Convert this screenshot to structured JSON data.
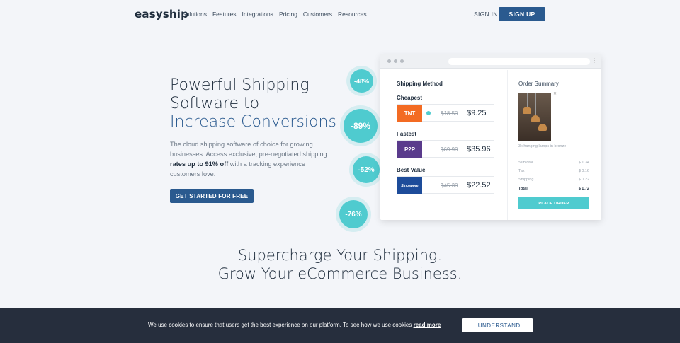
{
  "nav": {
    "logo": "easyship",
    "links": [
      "Solutions",
      "Features",
      "Integrations",
      "Pricing",
      "Customers",
      "Resources"
    ],
    "signin": "SIGN IN",
    "signup": "SIGN UP"
  },
  "hero": {
    "title_line1": "Powerful Shipping",
    "title_line2": "Software to",
    "title_line3": "Increase Conversions",
    "desc_part1": "The cloud shipping software of choice for growing businesses. Access exclusive, pre-negotiated shipping ",
    "desc_bold": "rates up to 91% off",
    "desc_part2": " with a tracking experience customers love.",
    "cta": "GET STARTED FOR FREE"
  },
  "bubbles": [
    "-48%",
    "-89%",
    "-52%",
    "-76%"
  ],
  "shipping_method": {
    "title": "Shipping Method",
    "options": [
      {
        "label": "Cheapest",
        "carrier": "TNT",
        "old_price": "$18.50",
        "new_price": "$9.25",
        "color": "#f36b23"
      },
      {
        "label": "Fastest",
        "carrier": "P2P",
        "old_price": "$69.90",
        "new_price": "$35.96",
        "color": "#5a3b8c"
      },
      {
        "label": "Best Value",
        "carrier": "Singapore",
        "old_price": "$45.30",
        "new_price": "$22.52",
        "color": "#1d4c9a"
      }
    ]
  },
  "order_summary": {
    "title": "Order Summary",
    "product_name": "3x hanging lamps in bronze",
    "rows": [
      {
        "label": "Subtotal",
        "value": "$ 1.34"
      },
      {
        "label": "Tax",
        "value": "$ 0.16"
      },
      {
        "label": "Shipping",
        "value": "$ 0.22"
      }
    ],
    "total_label": "Total",
    "total_value": "$ 1.72",
    "place_order": "PLACE ORDER"
  },
  "supercharge": {
    "line1": "Supercharge Your Shipping.",
    "line2": "Grow Your eCommerce Business."
  },
  "cookie": {
    "text": "We use cookies to ensure that users get the best experience on our platform. To see how we use cookies ",
    "link": "read more",
    "button": "I UNDERSTAND"
  },
  "colors": {
    "primary": "#2a5a8f",
    "accent": "#4fcbcf",
    "footer": "#262e3d"
  }
}
